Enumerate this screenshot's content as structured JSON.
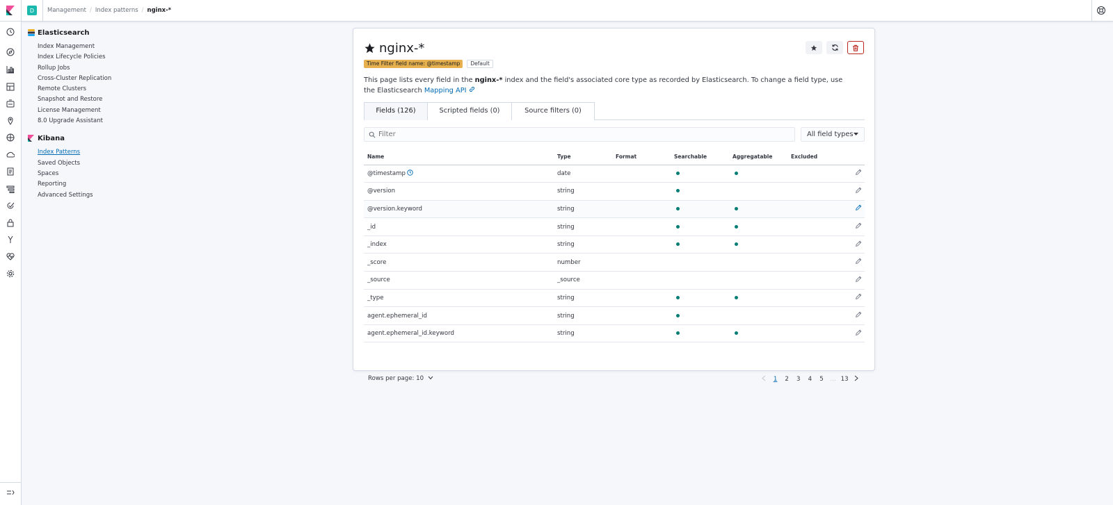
{
  "header": {
    "space_initial": "D",
    "breadcrumbs": [
      "Management",
      "Index patterns",
      "nginx-*"
    ]
  },
  "sidenav": {
    "groups": [
      {
        "title": "Elasticsearch",
        "items": [
          "Index Management",
          "Index Lifecycle Policies",
          "Rollup Jobs",
          "Cross-Cluster Replication",
          "Remote Clusters",
          "Snapshot and Restore",
          "License Management",
          "8.0 Upgrade Assistant"
        ]
      },
      {
        "title": "Kibana",
        "items": [
          "Index Patterns",
          "Saved Objects",
          "Spaces",
          "Reporting",
          "Advanced Settings"
        ],
        "active_item": "Index Patterns"
      }
    ]
  },
  "panel": {
    "title": "nginx-*",
    "badge_time": "Time Filter field name: @timestamp",
    "badge_default": "Default",
    "desc_pre": "This page lists every field in the ",
    "desc_index": "nginx-*",
    "desc_mid": " index and the field's associated core type as recorded by Elasticsearch. To change a field type, use the Elasticsearch ",
    "desc_link": "Mapping API",
    "tabs": [
      "Fields (126)",
      "Scripted fields (0)",
      "Source filters (0)"
    ],
    "filter_placeholder": "Filter",
    "type_filter": "All field types",
    "columns": [
      "Name",
      "Type",
      "Format",
      "Searchable",
      "Aggregatable",
      "Excluded"
    ],
    "rows": [
      {
        "name": "@timestamp",
        "type": "date",
        "format": "",
        "searchable": true,
        "aggregatable": true,
        "time": true
      },
      {
        "name": "@version",
        "type": "string",
        "format": "",
        "searchable": true,
        "aggregatable": false
      },
      {
        "name": "@version.keyword",
        "type": "string",
        "format": "",
        "searchable": true,
        "aggregatable": true,
        "hover": true
      },
      {
        "name": "_id",
        "type": "string",
        "format": "",
        "searchable": true,
        "aggregatable": true
      },
      {
        "name": "_index",
        "type": "string",
        "format": "",
        "searchable": true,
        "aggregatable": true
      },
      {
        "name": "_score",
        "type": "number",
        "format": "",
        "searchable": false,
        "aggregatable": false
      },
      {
        "name": "_source",
        "type": "_source",
        "format": "",
        "searchable": false,
        "aggregatable": false
      },
      {
        "name": "_type",
        "type": "string",
        "format": "",
        "searchable": true,
        "aggregatable": true
      },
      {
        "name": "agent.ephemeral_id",
        "type": "string",
        "format": "",
        "searchable": true,
        "aggregatable": false
      },
      {
        "name": "agent.ephemeral_id.keyword",
        "type": "string",
        "format": "",
        "searchable": true,
        "aggregatable": true
      }
    ],
    "rows_per_page": "Rows per page: 10",
    "pages": [
      "1",
      "2",
      "3",
      "4",
      "5",
      "...",
      "13"
    ],
    "current_page": "1"
  },
  "colors": {
    "accent": "#006bb4",
    "dot": "#017d73",
    "warning_badge": "#e6b04e",
    "danger": "#bd271e",
    "space_avatar": "#1bb9ad"
  }
}
